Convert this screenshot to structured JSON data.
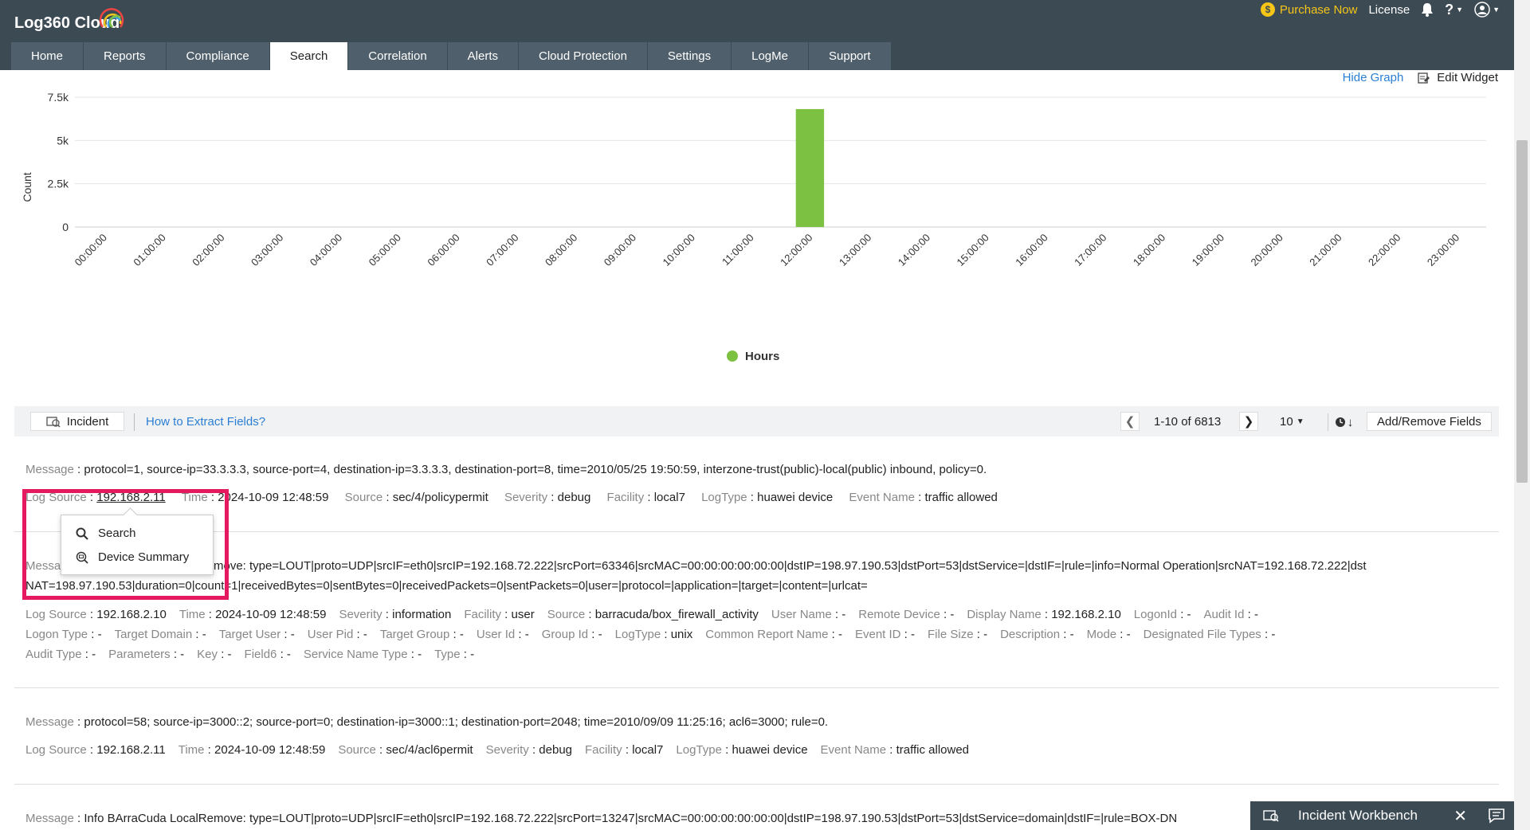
{
  "header": {
    "brand": "Log360 Cloud",
    "purchase_label": "Purchase Now",
    "license_label": "License",
    "help_label": "?"
  },
  "nav": {
    "tabs": [
      {
        "label": "Home",
        "active": false
      },
      {
        "label": "Reports",
        "active": false
      },
      {
        "label": "Compliance",
        "active": false
      },
      {
        "label": "Search",
        "active": true
      },
      {
        "label": "Correlation",
        "active": false
      },
      {
        "label": "Alerts",
        "active": false
      },
      {
        "label": "Cloud Protection",
        "active": false
      },
      {
        "label": "Settings",
        "active": false
      },
      {
        "label": "LogMe",
        "active": false
      },
      {
        "label": "Support",
        "active": false
      }
    ]
  },
  "graph_actions": {
    "hide_graph": "Hide Graph",
    "edit_widget": "Edit Widget"
  },
  "chart_data": {
    "type": "bar",
    "ylabel": "Count",
    "yticks": [
      "0",
      "2.5k",
      "5k",
      "7.5k"
    ],
    "ylim": [
      0,
      7500
    ],
    "categories": [
      "00:00:00",
      "01:00:00",
      "02:00:00",
      "03:00:00",
      "04:00:00",
      "05:00:00",
      "06:00:00",
      "07:00:00",
      "08:00:00",
      "09:00:00",
      "10:00:00",
      "11:00:00",
      "12:00:00",
      "13:00:00",
      "14:00:00",
      "15:00:00",
      "16:00:00",
      "17:00:00",
      "18:00:00",
      "19:00:00",
      "20:00:00",
      "21:00:00",
      "22:00:00",
      "23:00:00"
    ],
    "series": [
      {
        "name": "Hours",
        "color": "#7cc142",
        "values": [
          0,
          0,
          0,
          0,
          0,
          0,
          0,
          0,
          0,
          0,
          0,
          0,
          6813,
          0,
          0,
          0,
          0,
          0,
          0,
          0,
          0,
          0,
          0,
          0
        ]
      }
    ],
    "grid": true,
    "legend_position": "bottom-center"
  },
  "toolbar": {
    "incident_label": "Incident",
    "extract_link": "How to Extract Fields?",
    "pager_info": "1-10 of 6813",
    "per_page": "10",
    "add_remove": "Add/Remove Fields"
  },
  "records": [
    {
      "message_label": "Message",
      "message": "protocol=1, source-ip=33.3.3.3, source-port=4, destination-ip=3.3.3.3, destination-port=8, time=2010/05/25 19:50:59, interzone-trust(public)-local(public) inbound, policy=0.",
      "fields": [
        {
          "label": "Log Source",
          "value": "192.168.2.11"
        },
        {
          "label": "Time",
          "value": "2024-10-09 12:48:59"
        },
        {
          "label": "Source",
          "value": "sec/4/policypermit"
        },
        {
          "label": "Severity",
          "value": "debug"
        },
        {
          "label": "Facility",
          "value": "local7"
        },
        {
          "label": "LogType",
          "value": "huawei device"
        },
        {
          "label": "Event Name",
          "value": "traffic allowed"
        }
      ]
    },
    {
      "message_label": "Message",
      "message_line1": "Info BArraCuda LocalRemove: type=LOUT|proto=UDP|srcIF=eth0|srcIP=192.168.72.222|srcPort=63346|srcMAC=00:00:00:00:00:00|dstIP=198.97.190.53|dstPort=53|dstService=|dstIF=|rule=|info=Normal Operation|srcNAT=192.168.72.222|dst",
      "message_line2": "NAT=198.97.190.53|duration=0|count=1|receivedBytes=0|sentBytes=0|receivedPackets=0|sentPackets=0|user=|protocol=|application=|target=|content=|urlcat=",
      "fields_row1": [
        {
          "label": "Log Source",
          "value": "192.168.2.10"
        },
        {
          "label": "Time",
          "value": "2024-10-09 12:48:59"
        },
        {
          "label": "Severity",
          "value": "information"
        },
        {
          "label": "Facility",
          "value": "user"
        },
        {
          "label": "Source",
          "value": "barracuda/box_firewall_activity"
        },
        {
          "label": "User Name",
          "value": "-"
        },
        {
          "label": "Remote Device",
          "value": "-"
        },
        {
          "label": "Display Name",
          "value": "192.168.2.10"
        },
        {
          "label": "LogonId",
          "value": "-"
        },
        {
          "label": "Audit Id",
          "value": "-"
        }
      ],
      "fields_row2": [
        {
          "label": "Logon Type",
          "value": "-"
        },
        {
          "label": "Target Domain",
          "value": "-"
        },
        {
          "label": "Target User",
          "value": "-"
        },
        {
          "label": "User Pid",
          "value": "-"
        },
        {
          "label": "Target Group",
          "value": "-"
        },
        {
          "label": "User Id",
          "value": "-"
        },
        {
          "label": "Group Id",
          "value": "-"
        },
        {
          "label": "LogType",
          "value": "unix"
        },
        {
          "label": "Common Report Name",
          "value": "-"
        },
        {
          "label": "Event ID",
          "value": "-"
        },
        {
          "label": "File Size",
          "value": "-"
        },
        {
          "label": "Description",
          "value": "-"
        },
        {
          "label": "Mode",
          "value": "-"
        },
        {
          "label": "Designated File Types",
          "value": "-"
        }
      ],
      "fields_row3": [
        {
          "label": "Audit Type",
          "value": "-"
        },
        {
          "label": "Parameters",
          "value": "-"
        },
        {
          "label": "Key",
          "value": "-"
        },
        {
          "label": "Field6",
          "value": "-"
        },
        {
          "label": "Service Name Type",
          "value": "-"
        },
        {
          "label": "Type",
          "value": "-"
        }
      ]
    },
    {
      "message_label": "Message",
      "message": "protocol=58; source-ip=3000::2; source-port=0; destination-ip=3000::1; destination-port=2048; time=2010/09/09 11:25:16; acl6=3000; rule=0.",
      "fields": [
        {
          "label": "Log Source",
          "value": "192.168.2.11"
        },
        {
          "label": "Time",
          "value": "2024-10-09 12:48:59"
        },
        {
          "label": "Source",
          "value": "sec/4/acl6permit"
        },
        {
          "label": "Severity",
          "value": "debug"
        },
        {
          "label": "Facility",
          "value": "local7"
        },
        {
          "label": "LogType",
          "value": "huawei device"
        },
        {
          "label": "Event Name",
          "value": "traffic allowed"
        }
      ]
    },
    {
      "message_label": "Message",
      "message": "Info BArraCuda LocalRemove: type=LOUT|proto=UDP|srcIF=eth0|srcIP=192.168.72.222|srcPort=13247|srcMAC=00:00:00:00:00:00|dstIP=198.97.190.53|dstPort=53|dstService=domain|dstIF=|rule=BOX-DN"
    }
  ],
  "popup": {
    "search_label": "Search",
    "device_summary_label": "Device Summary"
  },
  "workbench": {
    "label": "Incident Workbench"
  },
  "colors": {
    "header_bg": "#3c4a54",
    "accent_link": "#2a7fd4",
    "bar_green": "#7cc142",
    "highlight": "#e5195f",
    "purchase": "#f5c518"
  }
}
